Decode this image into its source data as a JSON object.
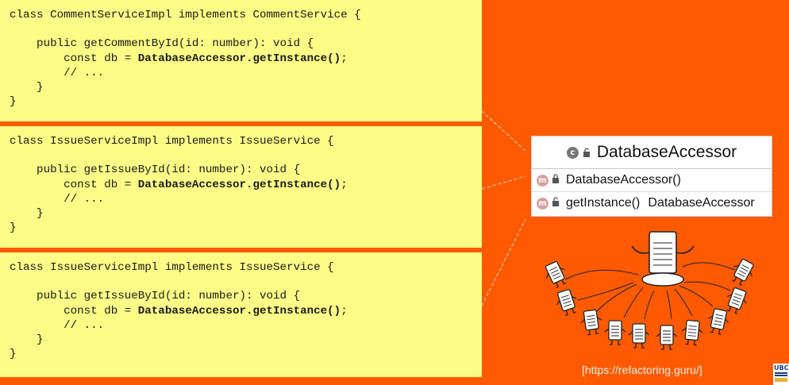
{
  "code_panels": [
    {
      "lines": [
        {
          "pre": "class CommentServiceImpl implements CommentService {"
        },
        {
          "pre": ""
        },
        {
          "pre": "    public getCommentById(id: number): void {"
        },
        {
          "pre": "        const db = ",
          "bold": "DatabaseAccessor.getInstance()",
          "post": ";"
        },
        {
          "pre": "        // ..."
        },
        {
          "pre": "    }"
        },
        {
          "pre": "}"
        }
      ]
    },
    {
      "lines": [
        {
          "pre": "class IssueServiceImpl implements IssueService {"
        },
        {
          "pre": ""
        },
        {
          "pre": "    public getIssueById(id: number): void {"
        },
        {
          "pre": "        const db = ",
          "bold": "DatabaseAccessor.getInstance()",
          "post": ";"
        },
        {
          "pre": "        // ..."
        },
        {
          "pre": "    }"
        },
        {
          "pre": "}"
        }
      ]
    },
    {
      "lines": [
        {
          "pre": "class IssueServiceImpl implements IssueService {"
        },
        {
          "pre": ""
        },
        {
          "pre": "    public getIssueById(id: number): void {"
        },
        {
          "pre": "        const db = ",
          "bold": "DatabaseAccessor.getInstance()",
          "post": ";"
        },
        {
          "pre": "        // ..."
        },
        {
          "pre": "    }"
        },
        {
          "pre": "}"
        }
      ]
    }
  ],
  "uml": {
    "class_badge": "c",
    "class_name": "DatabaseAccessor",
    "members": [
      {
        "badge": "m",
        "visibility": "private",
        "name": "DatabaseAccessor()",
        "return_type": ""
      },
      {
        "badge": "m",
        "visibility": "public",
        "static": true,
        "name": "getInstance()",
        "return_type": "DatabaseAccessor"
      }
    ]
  },
  "source_link": "[https://refactoring.guru/]",
  "logo_text": "UBC",
  "colors": {
    "background": "#ff5a00",
    "code_panel": "#fcfc87",
    "uml_card": "#ffffff",
    "member_badge": "#d9a0a0",
    "class_badge": "#777777"
  },
  "illustration": "singleton-clients-figures"
}
